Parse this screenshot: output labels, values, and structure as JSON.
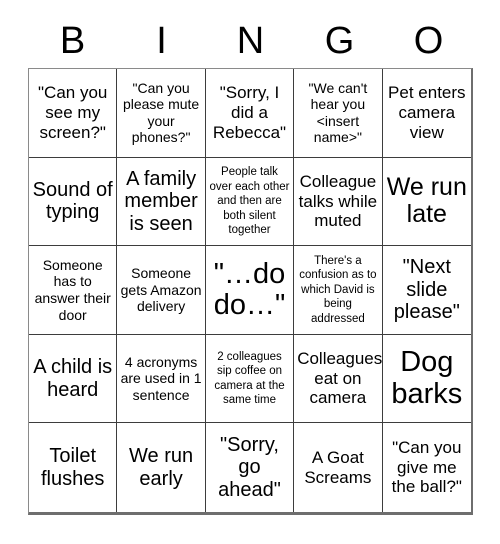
{
  "card": {
    "header_letters": [
      "B",
      "I",
      "N",
      "G",
      "O"
    ],
    "columns": 5,
    "rows": 5,
    "colors": {
      "background": "#ffffff",
      "text": "#000000",
      "cell_border": "#3d3d3d",
      "outer_border": "#6e6e6e"
    },
    "cells": [
      {
        "text": "\"Can you see my screen?\"",
        "size": "md"
      },
      {
        "text": "\"Can you please mute your phones?\"",
        "size": "sm"
      },
      {
        "text": "\"Sorry, I did a Rebecca\"",
        "size": "md"
      },
      {
        "text": "\"We can't hear you <insert name>\"",
        "size": "sm"
      },
      {
        "text": "Pet enters camera view",
        "size": "md"
      },
      {
        "text": "Sound of typing",
        "size": "lg"
      },
      {
        "text": "A family member is seen",
        "size": "lg"
      },
      {
        "text": "People talk over each other and then are both silent together",
        "size": "xs"
      },
      {
        "text": "Colleague talks while muted",
        "size": "md"
      },
      {
        "text": "We run late",
        "size": "xl"
      },
      {
        "text": "Someone has to answer their door",
        "size": "sm"
      },
      {
        "text": "Someone gets Amazon delivery",
        "size": "sm"
      },
      {
        "text": "\"…do do…\"",
        "size": "xxl"
      },
      {
        "text": "There's a confusion as to which David is being addressed",
        "size": "xs"
      },
      {
        "text": "\"Next slide please\"",
        "size": "lg"
      },
      {
        "text": "A child is heard",
        "size": "lg"
      },
      {
        "text": "4 acronyms are used in 1 sentence",
        "size": "sm"
      },
      {
        "text": "2 colleagues sip coffee on camera at the same time",
        "size": "xs"
      },
      {
        "text": "Colleagues eat on camera",
        "size": "md"
      },
      {
        "text": "Dog barks",
        "size": "xxl"
      },
      {
        "text": "Toilet flushes",
        "size": "lg"
      },
      {
        "text": "We run early",
        "size": "lg"
      },
      {
        "text": "\"Sorry, go ahead\"",
        "size": "lg"
      },
      {
        "text": "A Goat Screams",
        "size": "md"
      },
      {
        "text": "\"Can you give me the ball?\"",
        "size": "md"
      }
    ]
  }
}
